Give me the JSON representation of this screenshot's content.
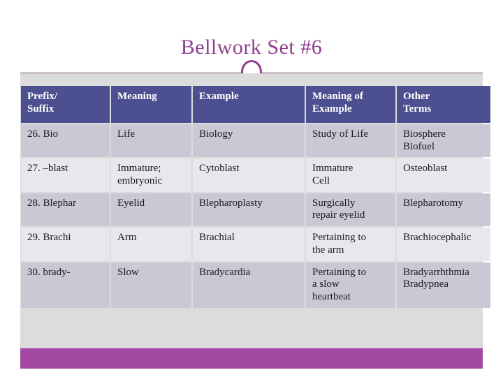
{
  "slide": {
    "title": "Bellwork Set #6",
    "ornament_icon": "circle-outline-icon",
    "colors": {
      "title_text": "#8e3f8e",
      "rule": "#7b4f7b",
      "table_header_bg": "#4d5090",
      "row_dark_bg": "#c9c9d6",
      "row_light_bg": "#e7e7ee",
      "content_band_bg": "#dcdcdc",
      "bottom_bar": "#a349a4"
    }
  },
  "table": {
    "headers": [
      "Prefix/ Suffix",
      "Meaning",
      "Example",
      "Meaning of Example",
      "Other Terms"
    ],
    "header_lines": [
      [
        "Prefix/",
        "Suffix"
      ],
      [
        "Meaning"
      ],
      [
        "Example"
      ],
      [
        "Meaning of",
        "Example"
      ],
      [
        "Other",
        "Terms"
      ]
    ],
    "rows": [
      {
        "prefix_suffix": [
          "26. Bio"
        ],
        "meaning": [
          "Life"
        ],
        "example": [
          "Biology"
        ],
        "meaning_of_example": [
          "Study of Life"
        ],
        "other_terms": [
          "Biosphere",
          "Biofuel"
        ]
      },
      {
        "prefix_suffix": [
          "27. –blast"
        ],
        "meaning": [
          "Immature;",
          "embryonic"
        ],
        "example": [
          "Cytoblast"
        ],
        "meaning_of_example": [
          "Immature",
          "Cell"
        ],
        "other_terms": [
          "Osteoblast"
        ]
      },
      {
        "prefix_suffix": [
          "28. Blephar"
        ],
        "meaning": [
          "Eyelid"
        ],
        "example": [
          "Blepharoplasty"
        ],
        "meaning_of_example": [
          "Surgically",
          "repair eyelid"
        ],
        "other_terms": [
          "Blepharotomy"
        ]
      },
      {
        "prefix_suffix": [
          "29. Brachi"
        ],
        "meaning": [
          "Arm"
        ],
        "example": [
          "Brachial"
        ],
        "meaning_of_example": [
          "Pertaining to",
          "the arm"
        ],
        "other_terms": [
          "Brachiocephalic"
        ]
      },
      {
        "prefix_suffix": [
          "30. brady-"
        ],
        "meaning": [
          "Slow"
        ],
        "example": [
          "Bradycardia"
        ],
        "meaning_of_example": [
          "Pertaining to",
          "a slow",
          "heartbeat"
        ],
        "other_terms": [
          "Bradyarrhthmia",
          "Bradypnea"
        ]
      }
    ]
  }
}
